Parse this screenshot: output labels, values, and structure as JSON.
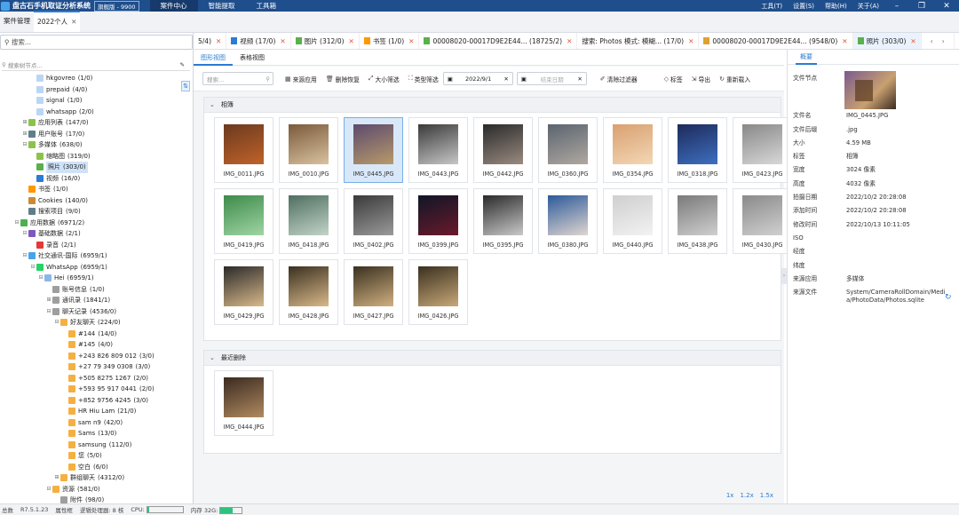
{
  "titlebar": {
    "app_title": "盘古石手机取证分析系统",
    "edition": "旗舰版 - 9900",
    "menus": [
      "案件中心",
      "智能提取",
      "工具箱"
    ],
    "right_menus": [
      "工具(T)",
      "设置(S)",
      "帮助(H)",
      "关于(A)"
    ]
  },
  "casebar": {
    "tabs": [
      "案件管理",
      "2022个人"
    ]
  },
  "view_tabs": [
    {
      "label": "5/4)",
      "icon": "none"
    },
    {
      "label": "视频 (17/0)",
      "icon": "video"
    },
    {
      "label": "图片 (312/0)",
      "icon": "image"
    },
    {
      "label": "书签 (1/0)",
      "icon": "bookmark"
    },
    {
      "label": "00008020-00017D9E2E44... (18725/2)",
      "icon": "file"
    },
    {
      "label": "搜索: Photos 模式: 模糊... (17/0)",
      "icon": "none"
    },
    {
      "label": "00008020-00017D9E2E44... (9548/0)",
      "icon": "folder"
    },
    {
      "label": "照片 (303/0)",
      "icon": "image"
    }
  ],
  "sidebar": {
    "search_placeholder": "搜索...",
    "node_search_placeholder": "搜索树节点...",
    "tree": [
      {
        "indent": 3,
        "label": "hkgovreo",
        "count": "(1/0)",
        "icon": "#bbd6f5",
        "toggle": ""
      },
      {
        "indent": 3,
        "label": "prepaid",
        "count": "(4/0)",
        "icon": "#bbd6f5",
        "toggle": ""
      },
      {
        "indent": 3,
        "label": "signal",
        "count": "(1/0)",
        "icon": "#bbd6f5",
        "toggle": ""
      },
      {
        "indent": 3,
        "label": "whatsapp",
        "count": "(2/0)",
        "icon": "#bbd6f5",
        "toggle": ""
      },
      {
        "indent": 2,
        "label": "应用列表",
        "count": "(147/0)",
        "icon": "#8bc34a",
        "toggle": "+"
      },
      {
        "indent": 2,
        "label": "用户账号",
        "count": "(17/0)",
        "icon": "#607d8b",
        "toggle": "+"
      },
      {
        "indent": 2,
        "label": "多媒体",
        "count": "(638/0)",
        "icon": "#8bc34a",
        "toggle": "-"
      },
      {
        "indent": 3,
        "label": "缩略图",
        "count": "(319/0)",
        "icon": "#8bc34a",
        "toggle": ""
      },
      {
        "indent": 3,
        "label": "照片",
        "count": "(303/0)",
        "icon": "#5ab04b",
        "toggle": "",
        "selected": true
      },
      {
        "indent": 3,
        "label": "视频",
        "count": "(16/0)",
        "icon": "#2b7cd3",
        "toggle": ""
      },
      {
        "indent": 2,
        "label": "书签",
        "count": "(1/0)",
        "icon": "#ff9800",
        "toggle": ""
      },
      {
        "indent": 2,
        "label": "Cookies",
        "count": "(140/0)",
        "icon": "#c98b3a",
        "toggle": ""
      },
      {
        "indent": 2,
        "label": "搜索项目",
        "count": "(9/0)",
        "icon": "#607d8b",
        "toggle": ""
      },
      {
        "indent": 1,
        "label": "应用数据",
        "count": "(6971/2)",
        "icon": "#4caf50",
        "toggle": "-"
      },
      {
        "indent": 2,
        "label": "基础数据",
        "count": "(2/1)",
        "icon": "#7e57c2",
        "toggle": "-"
      },
      {
        "indent": 3,
        "label": "录音",
        "count": "(2/1)",
        "icon": "#e53935",
        "toggle": ""
      },
      {
        "indent": 2,
        "label": "社交通讯-国际",
        "count": "(6959/1)",
        "icon": "#4aa3e8",
        "toggle": "-"
      },
      {
        "indent": 3,
        "label": "WhatsApp",
        "count": "(6959/1)",
        "icon": "#25d366",
        "toggle": "-"
      },
      {
        "indent": 4,
        "label": "Hei",
        "count": "(6959/1)",
        "icon": "#8bb7e8",
        "toggle": "-"
      },
      {
        "indent": 5,
        "label": "账号信息",
        "count": "(1/0)",
        "icon": "#9e9e9e",
        "toggle": ""
      },
      {
        "indent": 5,
        "label": "通讯录",
        "count": "(1841/1)",
        "icon": "#9e9e9e",
        "toggle": "+"
      },
      {
        "indent": 5,
        "label": "聊天记录",
        "count": "(4536/0)",
        "icon": "#9e9e9e",
        "toggle": "-"
      },
      {
        "indent": 6,
        "label": "好友聊天",
        "count": "(224/0)",
        "icon": "#f5b041",
        "toggle": "-"
      },
      {
        "indent": 7,
        "label": "#144",
        "count": "(14/0)",
        "icon": "#f5b041",
        "toggle": ""
      },
      {
        "indent": 7,
        "label": "#145",
        "count": "(4/0)",
        "icon": "#f5b041",
        "toggle": ""
      },
      {
        "indent": 7,
        "label": "+243 826 809 012",
        "count": "(3/0)",
        "icon": "#f5b041",
        "toggle": ""
      },
      {
        "indent": 7,
        "label": "+27 79 349 0308",
        "count": "(3/0)",
        "icon": "#f5b041",
        "toggle": ""
      },
      {
        "indent": 7,
        "label": "+505 8275 1267",
        "count": "(2/0)",
        "icon": "#f5b041",
        "toggle": ""
      },
      {
        "indent": 7,
        "label": "+593 95 917 0441",
        "count": "(2/0)",
        "icon": "#f5b041",
        "toggle": ""
      },
      {
        "indent": 7,
        "label": "+852 9756 4245",
        "count": "(3/0)",
        "icon": "#f5b041",
        "toggle": ""
      },
      {
        "indent": 7,
        "label": "HR Hiu Lam",
        "count": "(21/0)",
        "icon": "#f5b041",
        "toggle": ""
      },
      {
        "indent": 7,
        "label": "sam n9",
        "count": "(42/0)",
        "icon": "#f5b041",
        "toggle": ""
      },
      {
        "indent": 7,
        "label": "Sams",
        "count": "(13/0)",
        "icon": "#f5b041",
        "toggle": ""
      },
      {
        "indent": 7,
        "label": "samsung",
        "count": "(112/0)",
        "icon": "#f5b041",
        "toggle": ""
      },
      {
        "indent": 7,
        "label": "您",
        "count": "(5/0)",
        "icon": "#f5b041",
        "toggle": ""
      },
      {
        "indent": 7,
        "label": "空白",
        "count": "(6/0)",
        "icon": "#f5b041",
        "toggle": ""
      },
      {
        "indent": 6,
        "label": "群组聊天",
        "count": "(4312/0)",
        "icon": "#f5b041",
        "toggle": "+"
      },
      {
        "indent": 5,
        "label": "资源",
        "count": "(581/0)",
        "icon": "#f5b041",
        "toggle": "-"
      },
      {
        "indent": 6,
        "label": "附件",
        "count": "(98/0)",
        "icon": "#9e9e9e",
        "toggle": ""
      },
      {
        "indent": 6,
        "label": "视频",
        "count": "(17/0)",
        "icon": "#2b7cd3",
        "toggle": ""
      }
    ]
  },
  "main": {
    "subtabs": [
      "图形视图",
      "表格视图"
    ],
    "search_placeholder": "搜索...",
    "toolbar": [
      "来源应用",
      "删除恢复",
      "大小筛选",
      "类型筛选"
    ],
    "date_from": "2022/9/1",
    "date_to_placeholder": "结束日期",
    "toolbar_right": [
      "清除过滤器",
      "标签",
      "导出",
      "重新载入"
    ],
    "sections": [
      {
        "title": "相簿",
        "tiles": [
          {
            "name": "IMG_0011.JPG",
            "c1": "#6b3a1f",
            "c2": "#c0622a"
          },
          {
            "name": "IMG_0010.JPG",
            "c1": "#7a5a3a",
            "c2": "#d9c2a0"
          },
          {
            "name": "IMG_0445.JPG",
            "c1": "#5d4a6e",
            "c2": "#b79a6a",
            "selected": true
          },
          {
            "name": "IMG_0443.JPG",
            "c1": "#3a3a3a",
            "c2": "#c7c7c7"
          },
          {
            "name": "IMG_0442.JPG",
            "c1": "#2a2a2a",
            "c2": "#9a8b80"
          },
          {
            "name": "IMG_0360.JPG",
            "c1": "#5a6470",
            "c2": "#b0a8a0"
          },
          {
            "name": "IMG_0354.JPG",
            "c1": "#d9a070",
            "c2": "#f3d7b5"
          },
          {
            "name": "IMG_0318.JPG",
            "c1": "#1d2a5a",
            "c2": "#3e6fc0"
          },
          {
            "name": "IMG_0423.JPG",
            "c1": "#888",
            "c2": "#d8d8d8"
          },
          {
            "name": "IMG_0419.JPG",
            "c1": "#3e8a4a",
            "c2": "#9fd5a4"
          },
          {
            "name": "IMG_0418.JPG",
            "c1": "#4f6f60",
            "c2": "#c2d4c8"
          },
          {
            "name": "IMG_0402.JPG",
            "c1": "#3a3a3a",
            "c2": "#9a9a9a"
          },
          {
            "name": "IMG_0399.JPG",
            "c1": "#0f1628",
            "c2": "#6a1a2a"
          },
          {
            "name": "IMG_0395.JPG",
            "c1": "#2a2a2a",
            "c2": "#c9c9c9"
          },
          {
            "name": "IMG_0380.JPG",
            "c1": "#2c5a9a",
            "c2": "#e0d6d0"
          },
          {
            "name": "IMG_0440.JPG",
            "c1": "#cfcfcf",
            "c2": "#f2f2f2"
          },
          {
            "name": "IMG_0438.JPG",
            "c1": "#7a7a7a",
            "c2": "#cfcfcf"
          },
          {
            "name": "IMG_0430.JPG",
            "c1": "#8a8a8a",
            "c2": "#d0d0d0"
          },
          {
            "name": "IMG_0429.JPG",
            "c1": "#2a2a2a",
            "c2": "#d9b98a"
          },
          {
            "name": "IMG_0428.JPG",
            "c1": "#3a3020",
            "c2": "#d9b98a"
          },
          {
            "name": "IMG_0427.JPG",
            "c1": "#3a3020",
            "c2": "#d0b080"
          },
          {
            "name": "IMG_0426.JPG",
            "c1": "#3a3020",
            "c2": "#c8a878"
          }
        ]
      },
      {
        "title": "最近删除",
        "tiles": [
          {
            "name": "IMG_0444.JPG",
            "c1": "#3a2a20",
            "c2": "#b08a60"
          }
        ]
      }
    ],
    "zoom_levels": [
      "1x",
      "1.2x",
      "1.5x"
    ]
  },
  "details": {
    "tab": "概要",
    "rows": [
      {
        "k": "文件节点",
        "v": ""
      },
      {
        "k": "文件名",
        "v": "IMG_0445.JPG"
      },
      {
        "k": "文件后缀",
        "v": ".jpg"
      },
      {
        "k": "大小",
        "v": "4.59 MB"
      },
      {
        "k": "标签",
        "v": "相簿"
      },
      {
        "k": "宽度",
        "v": "3024 像素"
      },
      {
        "k": "高度",
        "v": "4032 像素"
      },
      {
        "k": "拍摄日期",
        "v": "2022/10/2 20:28:08"
      },
      {
        "k": "添加时间",
        "v": "2022/10/2 20:28:08"
      },
      {
        "k": "修改时间",
        "v": "2022/10/13 10:11:05"
      },
      {
        "k": "ISO",
        "v": ""
      },
      {
        "k": "经度",
        "v": ""
      },
      {
        "k": "纬度",
        "v": ""
      },
      {
        "k": "来源应用",
        "v": "多媒体"
      },
      {
        "k": "来源文件",
        "v": "System/CameraRollDomain/Media/PhotoData/Photos.sqlite"
      }
    ]
  },
  "statusbar": {
    "items": [
      "总数",
      "R7.5.1.23",
      "属性框",
      "逻辑处理器: 8 核",
      "CPU:",
      "内存 32G:"
    ],
    "cpu_fraction": 0.05,
    "mem_fraction": 0.55
  },
  "colors": {
    "accent": "#2b7cd3",
    "titlebar": "#1f4e8c",
    "close_x": "#e05a3a"
  }
}
